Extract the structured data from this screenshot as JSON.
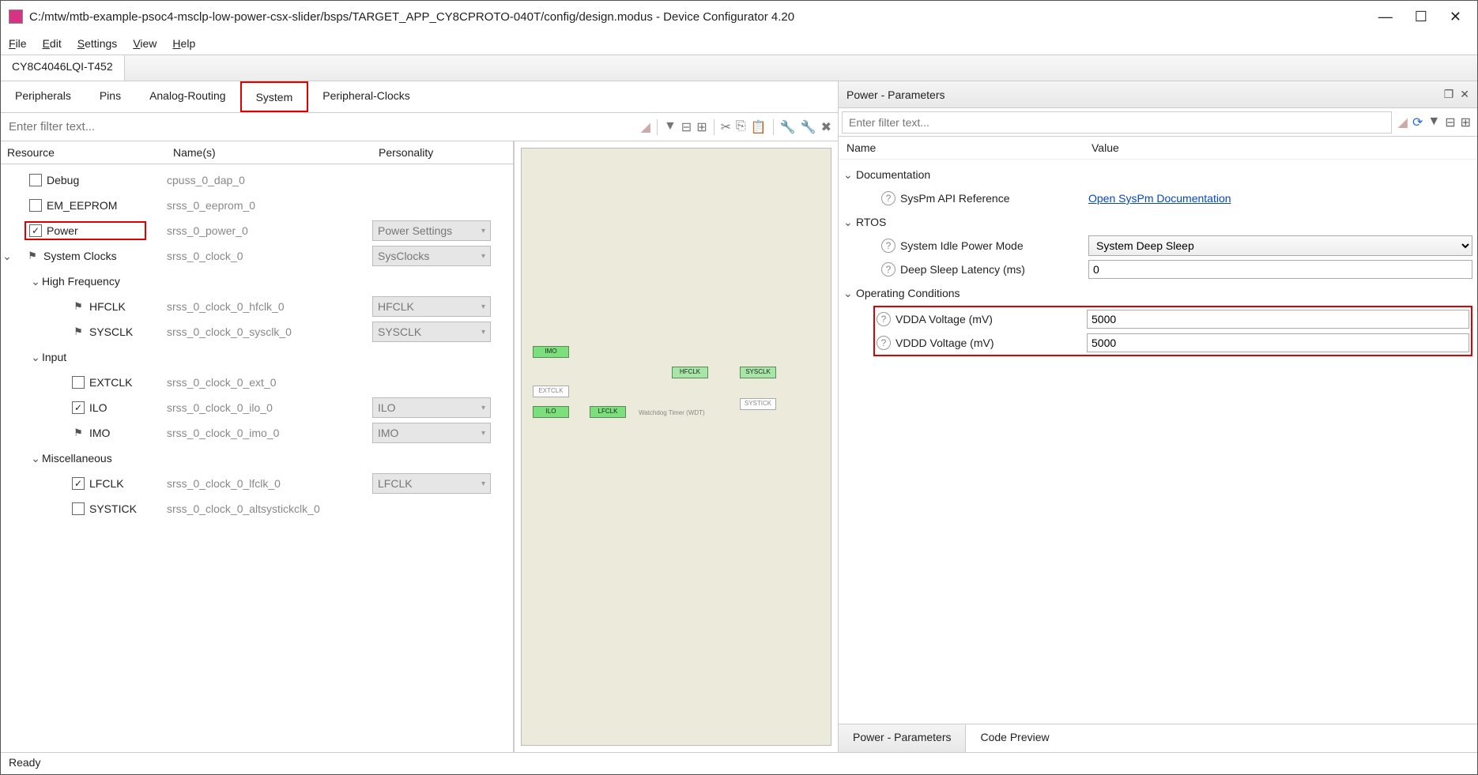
{
  "window": {
    "title": "C:/mtw/mtb-example-psoc4-msclp-low-power-csx-slider/bsps/TARGET_APP_CY8CPROTO-040T/config/design.modus - Device Configurator 4.20"
  },
  "menubar": [
    "File",
    "Edit",
    "Settings",
    "View",
    "Help"
  ],
  "chip_tab": "CY8C4046LQI-T452",
  "subtabs": [
    "Peripherals",
    "Pins",
    "Analog-Routing",
    "System",
    "Peripheral-Clocks"
  ],
  "subtab_active": "System",
  "left_filter_placeholder": "Enter filter text...",
  "tree_headers": {
    "resource": "Resource",
    "name": "Name(s)",
    "personality": "Personality"
  },
  "tree": {
    "debug": {
      "label": "Debug",
      "name": "cpuss_0_dap_0",
      "checked": false
    },
    "em_eeprom": {
      "label": "EM_EEPROM",
      "name": "srss_0_eeprom_0",
      "checked": false
    },
    "power": {
      "label": "Power",
      "name": "srss_0_power_0",
      "checked": true,
      "personality": "Power Settings"
    },
    "system_clocks": {
      "label": "System Clocks",
      "name": "srss_0_clock_0",
      "locked": true,
      "personality": "SysClocks"
    },
    "high_frequency": {
      "label": "High Frequency"
    },
    "hfclk": {
      "label": "HFCLK",
      "name": "srss_0_clock_0_hfclk_0",
      "locked": true,
      "personality": "HFCLK"
    },
    "sysclk": {
      "label": "SYSCLK",
      "name": "srss_0_clock_0_sysclk_0",
      "locked": true,
      "personality": "SYSCLK"
    },
    "input": {
      "label": "Input"
    },
    "extclk": {
      "label": "EXTCLK",
      "name": "srss_0_clock_0_ext_0",
      "checked": false
    },
    "ilo": {
      "label": "ILO",
      "name": "srss_0_clock_0_ilo_0",
      "checked": true,
      "personality": "ILO"
    },
    "imo": {
      "label": "IMO",
      "name": "srss_0_clock_0_imo_0",
      "locked": true,
      "personality": "IMO"
    },
    "misc": {
      "label": "Miscellaneous"
    },
    "lfclk": {
      "label": "LFCLK",
      "name": "srss_0_clock_0_lfclk_0",
      "checked": true,
      "personality": "LFCLK"
    },
    "systick": {
      "label": "SYSTICK",
      "name": "srss_0_clock_0_altsystickclk_0",
      "checked": false
    }
  },
  "diagram": {
    "imo": "IMO",
    "extclk": "EXTCLK",
    "ilo": "ILO",
    "lfclk": "LFCLK",
    "hfclk": "HFCLK",
    "sysclk": "SYSCLK",
    "systick": "SYSTICK",
    "wdt": "Watchdog Timer (WDT)"
  },
  "right": {
    "title": "Power - Parameters",
    "filter_placeholder": "Enter filter text...",
    "headers": {
      "name": "Name",
      "value": "Value"
    },
    "groups": {
      "documentation": "Documentation",
      "syspm_label": "SysPm API Reference",
      "syspm_link": "Open SysPm Documentation",
      "rtos": "RTOS",
      "idle_label": "System Idle Power Mode",
      "idle_value": "System Deep Sleep",
      "latency_label": "Deep Sleep Latency (ms)",
      "latency_value": "0",
      "opcond": "Operating Conditions",
      "vdda_label": "VDDA Voltage (mV)",
      "vdda_value": "5000",
      "vddd_label": "VDDD Voltage (mV)",
      "vddd_value": "5000"
    },
    "bottom_tabs": [
      "Power - Parameters",
      "Code Preview"
    ]
  },
  "status": "Ready"
}
